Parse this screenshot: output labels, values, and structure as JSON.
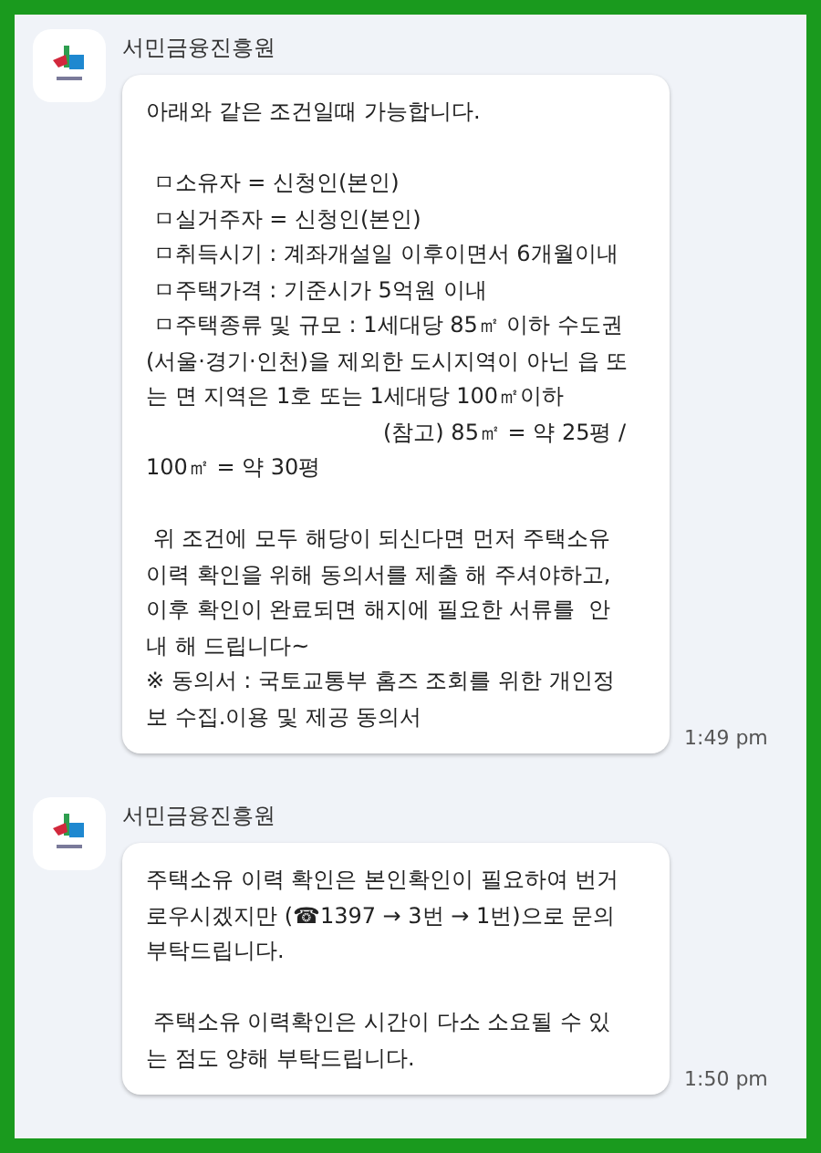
{
  "messages": [
    {
      "sender": "서민금융진흥원",
      "time": "1:49 pm",
      "paragraphs": [
        [
          {
            "text": "아래와 같은 조건일때 가능합니다."
          }
        ],
        [
          {
            "text": " ㅁ소유자 = 신청인(본인)"
          },
          {
            "text": " ㅁ실거주자 = 신청인(본인)"
          },
          {
            "text": " ㅁ취득시기 : 계좌개설일 이후이면서 6개월이내"
          },
          {
            "text": " ㅁ주택가격 : 기준시가 5억원 이내"
          },
          {
            "text": " ㅁ주택종류 및 규모 : 1세대당 85㎡ 이하 수도권"
          },
          {
            "text": "(서울·경기·인천)을 제외한 도시지역이 아닌 읍 또"
          },
          {
            "text": "는 면 지역은 1호 또는 1세대당 100㎡이하"
          },
          {
            "text": "(참고) 85㎡ = 약 25평 /",
            "kind": "indented"
          },
          {
            "text": "100㎡ = 약 30평"
          }
        ],
        [
          {
            "text": " 위 조건에 모두 해당이 되신다면 먼저 주택소유"
          },
          {
            "text": "이력 확인을 위해 동의서를 제출 해 주셔야하고,"
          },
          {
            "text": "이후 확인이 완료되면 해지에 필요한 서류를  안"
          },
          {
            "text": "내 해 드립니다~"
          },
          {
            "text": "※ 동의서 : 국토교통부 홈즈 조회를 위한 개인정"
          },
          {
            "text": "보 수집.이용 및 제공 동의서"
          }
        ]
      ]
    },
    {
      "sender": "서민금융진흥원",
      "time": "1:50 pm",
      "paragraphs": [
        [
          {
            "text": "주택소유 이력 확인은 본인확인이 필요하여 번거"
          },
          {
            "text": "로우시겠지만 (☎1397 → 3번 → 1번)으로 문의"
          },
          {
            "text": "부탁드립니다."
          }
        ],
        [
          {
            "text": " 주택소유 이력확인은 시간이 다소 소요될 수 있"
          },
          {
            "text": "는 점도 양해 부탁드립니다."
          }
        ]
      ]
    }
  ]
}
